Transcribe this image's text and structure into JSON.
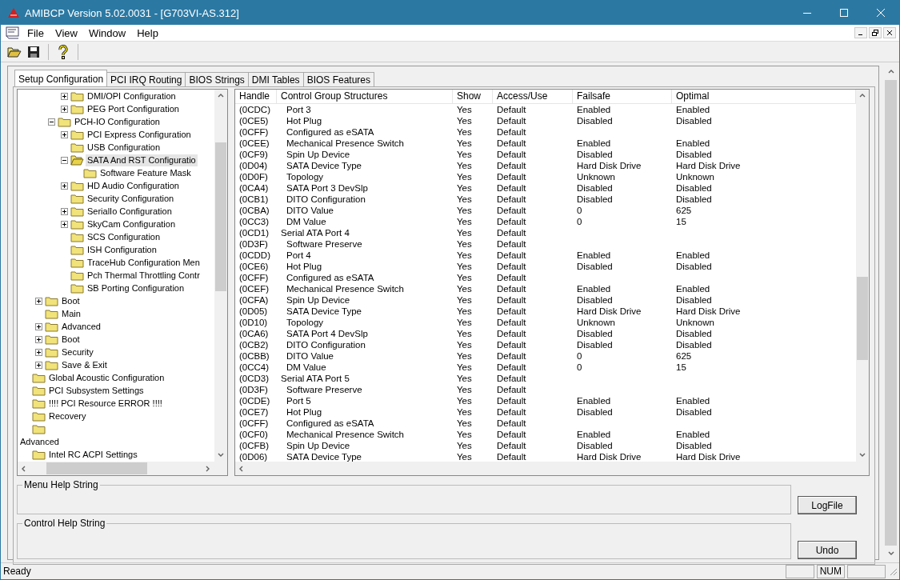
{
  "window": {
    "title": "AMIBCP Version 5.02.0031 - [G703VI-AS.312]"
  },
  "menu": [
    "File",
    "View",
    "Window",
    "Help"
  ],
  "tabs": [
    {
      "label": "Setup Configuration",
      "selected": true
    },
    {
      "label": "PCI IRQ Routing",
      "selected": false
    },
    {
      "label": "BIOS Strings",
      "selected": false
    },
    {
      "label": "DMI Tables",
      "selected": false
    },
    {
      "label": "BIOS Features",
      "selected": false
    }
  ],
  "tree": {
    "items": [
      {
        "children": [
          {
            "children": [
              {
                "children": [
                  {
                    "label": "DMI/OPI Configuration",
                    "expanded": false,
                    "selected": false
                  },
                  {
                    "label": "PEG Port Configuration",
                    "expanded": false,
                    "selected": false
                  }
                ]
              },
              {
                "label": "PCH-IO Configuration",
                "expanded": true,
                "selected": false,
                "children": [
                  {
                    "label": "PCI Express Configuration",
                    "expanded": false,
                    "selected": false
                  },
                  {
                    "label": "USB Configuration",
                    "selected": false
                  },
                  {
                    "label": "SATA And RST Configuratio",
                    "expanded": true,
                    "selected": true,
                    "children": [
                      {
                        "label": "Software Feature Mask",
                        "selected": false
                      }
                    ]
                  },
                  {
                    "label": "HD Audio Configuration",
                    "expanded": false,
                    "selected": false
                  },
                  {
                    "label": "Security Configuration",
                    "selected": false
                  },
                  {
                    "label": "SerialIo Configuration",
                    "expanded": false,
                    "selected": false
                  },
                  {
                    "label": "SkyCam Configuration",
                    "expanded": false,
                    "selected": false
                  },
                  {
                    "label": "SCS Configuration",
                    "selected": false
                  },
                  {
                    "label": "ISH Configuration",
                    "selected": false
                  },
                  {
                    "label": "TraceHub Configuration Men",
                    "selected": false
                  },
                  {
                    "label": "Pch Thermal Throttling Contr",
                    "selected": false
                  },
                  {
                    "label": "SB Porting Configuration",
                    "selected": false
                  }
                ]
              }
            ]
          },
          {
            "label": "Boot",
            "expanded": false,
            "selected": false
          },
          {
            "label": "Main",
            "selected": false
          },
          {
            "label": "Advanced",
            "expanded": false,
            "selected": false
          },
          {
            "label": "Boot",
            "expanded": false,
            "selected": false
          },
          {
            "label": "Security",
            "expanded": false,
            "selected": false
          },
          {
            "label": "Save & Exit",
            "expanded": false,
            "selected": false
          }
        ]
      },
      {
        "label": "Global Acoustic Configuration",
        "selected": false
      },
      {
        "label": "PCI Subsystem Settings",
        "selected": false
      },
      {
        "label": "!!!! PCI Resource ERROR !!!!",
        "selected": false
      },
      {
        "label": "Recovery",
        "selected": false
      },
      {
        "label": "Advanced",
        "selected": false,
        "kind": "wrapped"
      },
      {
        "label": "Intel RC ACPI Settings",
        "selected": false
      }
    ]
  },
  "table": {
    "columns": [
      "Handle",
      "Control Group Structures",
      "Show",
      "Access/Use",
      "Failsafe",
      "Optimal"
    ],
    "rows": [
      {
        "kind": "setting",
        "cells": [
          "(0CDC)",
          "Port 3",
          "Yes",
          "Default",
          "Enabled",
          "Enabled"
        ]
      },
      {
        "kind": "setting",
        "cells": [
          "(0CE5)",
          "Hot Plug",
          "Yes",
          "Default",
          "Disabled",
          "Disabled"
        ]
      },
      {
        "kind": "setting",
        "cells": [
          "(0CFF)",
          "Configured as eSATA",
          "Yes",
          "Default",
          "",
          ""
        ]
      },
      {
        "kind": "setting",
        "cells": [
          "(0CEE)",
          "Mechanical Presence Switch",
          "Yes",
          "Default",
          "Enabled",
          "Enabled"
        ]
      },
      {
        "kind": "setting",
        "cells": [
          "(0CF9)",
          "Spin Up Device",
          "Yes",
          "Default",
          "Disabled",
          "Disabled"
        ]
      },
      {
        "kind": "setting",
        "cells": [
          "(0D04)",
          "SATA Device Type",
          "Yes",
          "Default",
          "Hard Disk Drive",
          "Hard Disk Drive"
        ]
      },
      {
        "kind": "setting",
        "cells": [
          "(0D0F)",
          "Topology",
          "Yes",
          "Default",
          "Unknown",
          "Unknown"
        ]
      },
      {
        "kind": "setting",
        "cells": [
          "(0CA4)",
          "SATA Port 3 DevSlp",
          "Yes",
          "Default",
          "Disabled",
          "Disabled"
        ]
      },
      {
        "kind": "setting",
        "cells": [
          "(0CB1)",
          "DITO Configuration",
          "Yes",
          "Default",
          "Disabled",
          "Disabled"
        ]
      },
      {
        "kind": "setting",
        "cells": [
          "(0CBA)",
          "DITO Value",
          "Yes",
          "Default",
          "0",
          "625"
        ]
      },
      {
        "kind": "setting",
        "cells": [
          "(0CC3)",
          "DM Value",
          "Yes",
          "Default",
          "0",
          "15"
        ]
      },
      {
        "kind": "group",
        "cells": [
          "(0CD1)",
          "Serial ATA Port 4",
          "Yes",
          "Default",
          "",
          ""
        ]
      },
      {
        "kind": "setting",
        "cells": [
          "(0D3F)",
          "Software Preserve",
          "Yes",
          "Default",
          "",
          ""
        ]
      },
      {
        "kind": "setting",
        "cells": [
          "(0CDD)",
          "Port 4",
          "Yes",
          "Default",
          "Enabled",
          "Enabled"
        ]
      },
      {
        "kind": "setting",
        "cells": [
          "(0CE6)",
          "Hot Plug",
          "Yes",
          "Default",
          "Disabled",
          "Disabled"
        ]
      },
      {
        "kind": "setting",
        "cells": [
          "(0CFF)",
          "Configured as eSATA",
          "Yes",
          "Default",
          "",
          ""
        ]
      },
      {
        "kind": "setting",
        "cells": [
          "(0CEF)",
          "Mechanical Presence Switch",
          "Yes",
          "Default",
          "Enabled",
          "Enabled"
        ]
      },
      {
        "kind": "setting",
        "cells": [
          "(0CFA)",
          "Spin Up Device",
          "Yes",
          "Default",
          "Disabled",
          "Disabled"
        ]
      },
      {
        "kind": "setting",
        "cells": [
          "(0D05)",
          "SATA Device Type",
          "Yes",
          "Default",
          "Hard Disk Drive",
          "Hard Disk Drive"
        ]
      },
      {
        "kind": "setting",
        "cells": [
          "(0D10)",
          "Topology",
          "Yes",
          "Default",
          "Unknown",
          "Unknown"
        ]
      },
      {
        "kind": "setting",
        "cells": [
          "(0CA6)",
          "SATA Port 4 DevSlp",
          "Yes",
          "Default",
          "Disabled",
          "Disabled"
        ]
      },
      {
        "kind": "setting",
        "cells": [
          "(0CB2)",
          "DITO Configuration",
          "Yes",
          "Default",
          "Disabled",
          "Disabled"
        ]
      },
      {
        "kind": "setting",
        "cells": [
          "(0CBB)",
          "DITO Value",
          "Yes",
          "Default",
          "0",
          "625"
        ]
      },
      {
        "kind": "setting",
        "cells": [
          "(0CC4)",
          "DM Value",
          "Yes",
          "Default",
          "0",
          "15"
        ]
      },
      {
        "kind": "group",
        "cells": [
          "(0CD3)",
          "Serial ATA Port 5",
          "Yes",
          "Default",
          "",
          ""
        ]
      },
      {
        "kind": "setting",
        "cells": [
          "(0D3F)",
          "Software Preserve",
          "Yes",
          "Default",
          "",
          ""
        ]
      },
      {
        "kind": "setting",
        "cells": [
          "(0CDE)",
          "Port 5",
          "Yes",
          "Default",
          "Enabled",
          "Enabled"
        ]
      },
      {
        "kind": "setting",
        "cells": [
          "(0CE7)",
          "Hot Plug",
          "Yes",
          "Default",
          "Disabled",
          "Disabled"
        ]
      },
      {
        "kind": "setting",
        "cells": [
          "(0CFF)",
          "Configured as eSATA",
          "Yes",
          "Default",
          "",
          ""
        ]
      },
      {
        "kind": "setting",
        "cells": [
          "(0CF0)",
          "Mechanical Presence Switch",
          "Yes",
          "Default",
          "Enabled",
          "Enabled"
        ]
      },
      {
        "kind": "setting",
        "cells": [
          "(0CFB)",
          "Spin Up Device",
          "Yes",
          "Default",
          "Disabled",
          "Disabled"
        ]
      },
      {
        "kind": "setting",
        "cells": [
          "(0D06)",
          "SATA Device Type",
          "Yes",
          "Default",
          "Hard Disk Drive",
          "Hard Disk Drive"
        ]
      }
    ]
  },
  "help_groups": [
    "Menu Help String",
    "Control Help String"
  ],
  "buttons": [
    "LogFile",
    "Undo"
  ],
  "status_bar": {
    "text": "Ready",
    "indicator": "NUM"
  }
}
